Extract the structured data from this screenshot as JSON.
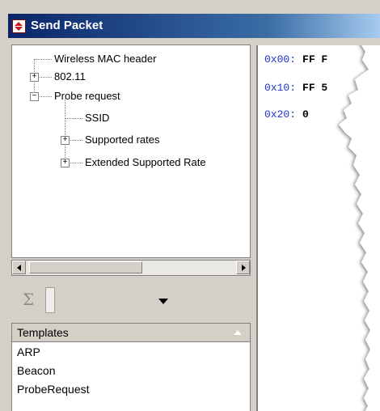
{
  "window": {
    "title": "Send Packet",
    "icon": "diamond-arrows-icon"
  },
  "tree": {
    "items": [
      {
        "label": "Wireless MAC header",
        "expander": "",
        "level": 0
      },
      {
        "label": "802.11",
        "expander": "+",
        "level": 0
      },
      {
        "label": "Probe request",
        "expander": "−",
        "level": 0
      },
      {
        "label": "SSID",
        "expander": "",
        "level": 1
      },
      {
        "label": "Supported rates",
        "expander": "+",
        "level": 1
      },
      {
        "label": "Extended Supported Rate",
        "expander": "+",
        "level": 1
      }
    ]
  },
  "scrollbar": {
    "left_icon": "scroll-left-arrow-icon",
    "right_icon": "scroll-right-arrow-icon"
  },
  "toolbar": {
    "sigma_symbol": "Σ",
    "dropdown_icon": "dropdown-arrow-icon"
  },
  "templates": {
    "header": "Templates",
    "items": [
      "ARP",
      "Beacon",
      "ProbeRequest"
    ]
  },
  "hex": {
    "rows": [
      {
        "addr": "0x00:",
        "bytes": "FF F"
      },
      {
        "addr": "0x10:",
        "bytes": "FF 5"
      },
      {
        "addr": "0x20:",
        "bytes": "0"
      }
    ]
  },
  "colors": {
    "title_bar": "#0a246a",
    "hex_address": "#1f35c8",
    "chrome": "#d4d0c8"
  }
}
